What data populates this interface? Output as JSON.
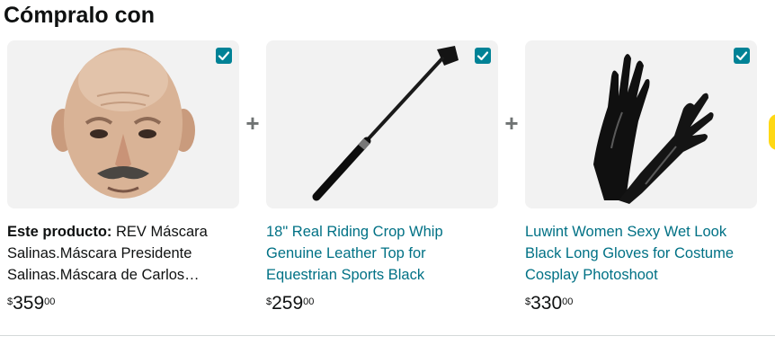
{
  "section": {
    "title": "Cómpralo con"
  },
  "products": [
    {
      "prefix": "Este producto:",
      "description": "REV Máscara Salinas.Máscara Presidente Salinas.Máscara de Carlos…",
      "price": {
        "symbol": "$",
        "whole": "359",
        "fraction": "00"
      },
      "checked": true,
      "image": "latex-bald-old-man-mask"
    },
    {
      "prefix": "",
      "description": "18\" Real Riding Crop Whip Genuine Leather Top for Equestrian Sports Black",
      "price": {
        "symbol": "$",
        "whole": "259",
        "fraction": "00"
      },
      "checked": true,
      "image": "black-riding-crop"
    },
    {
      "prefix": "",
      "description": "Luwint Women Sexy Wet Look Black Long Gloves for Costume Cosplay Photoshoot",
      "price": {
        "symbol": "$",
        "whole": "330",
        "fraction": "00"
      },
      "checked": true,
      "image": "black-long-gloves"
    }
  ],
  "separators": {
    "plus": "+"
  },
  "colors": {
    "link": "#007185",
    "checkbox": "#008296",
    "image_bg": "#f2f2f2"
  }
}
